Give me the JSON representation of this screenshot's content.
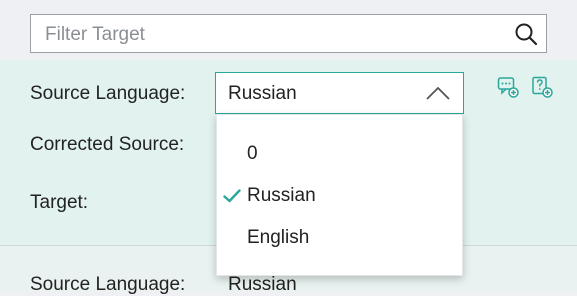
{
  "search": {
    "placeholder": "Filter Target"
  },
  "form": {
    "source_language_label": "Source Language:",
    "corrected_source_label": "Corrected Source:",
    "target_label": "Target:",
    "selected_value": "Russian"
  },
  "dropdown": {
    "options": [
      {
        "label": "0",
        "selected": false
      },
      {
        "label": "Russian",
        "selected": true
      },
      {
        "label": "English",
        "selected": false
      }
    ]
  },
  "next_entry": {
    "source_language_label": "Source Language:",
    "source_language_value": "Russian"
  },
  "icons": {
    "search": "search-icon",
    "chevron": "chevron-up-icon",
    "comment_add": "add-comment-icon",
    "help_add": "add-question-icon",
    "check": "check-icon"
  },
  "colors": {
    "accent": "#2aa79b",
    "panel": "#e2f3ef"
  }
}
